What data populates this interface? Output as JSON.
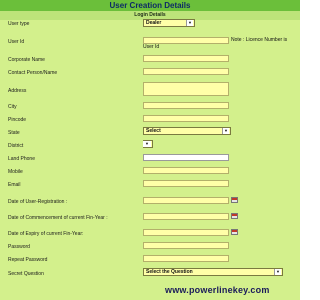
{
  "header": {
    "title": "User Creation Details",
    "section": "Login Details"
  },
  "fields": {
    "user_type": {
      "label": "User type",
      "value": "Dealer"
    },
    "user_id": {
      "label": "User Id",
      "note": "Note : Licence Number is",
      "note_continuation": "User Id"
    },
    "corporate_name": {
      "label": "Corporate Name"
    },
    "contact_person": {
      "label": "Contact Person/Name"
    },
    "address": {
      "label": "Address"
    },
    "city": {
      "label": "City"
    },
    "pincode": {
      "label": "Pincode"
    },
    "state": {
      "label": "State",
      "value": "Select"
    },
    "district": {
      "label": "District"
    },
    "land_phone": {
      "label": "Land Phone"
    },
    "mobile": {
      "label": "Mobile"
    },
    "email": {
      "label": "Email"
    },
    "date_registration": {
      "label": "Date of User-Registration :"
    },
    "date_commencement": {
      "label": "Date of Commencement of current Fin-Year :"
    },
    "date_expiry": {
      "label": "Date of Expiry of current Fin-Year:"
    },
    "password": {
      "label": "Password"
    },
    "repeat_password": {
      "label": "Repeat Password"
    },
    "secret_question": {
      "label": "Secret Question",
      "value": "Select the Question"
    }
  },
  "watermark": "www.powerlinekey.com"
}
